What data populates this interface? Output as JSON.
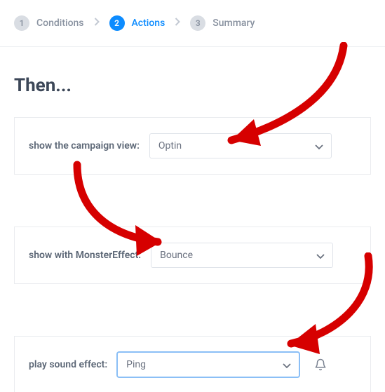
{
  "stepper": {
    "steps": [
      {
        "num": "1",
        "label": "Conditions",
        "active": false
      },
      {
        "num": "2",
        "label": "Actions",
        "active": true
      },
      {
        "num": "3",
        "label": "Summary",
        "active": false
      }
    ]
  },
  "heading": "Then...",
  "rows": {
    "campaign_view": {
      "label": "show the campaign view:",
      "selected": "Optin"
    },
    "monster_effect": {
      "label": "show with MonsterEffect:",
      "selected": "Bounce"
    },
    "sound_effect": {
      "label": "play sound effect:",
      "selected": "Ping"
    }
  },
  "colors": {
    "accent": "#0d8cff",
    "annotation": "#d60000"
  }
}
